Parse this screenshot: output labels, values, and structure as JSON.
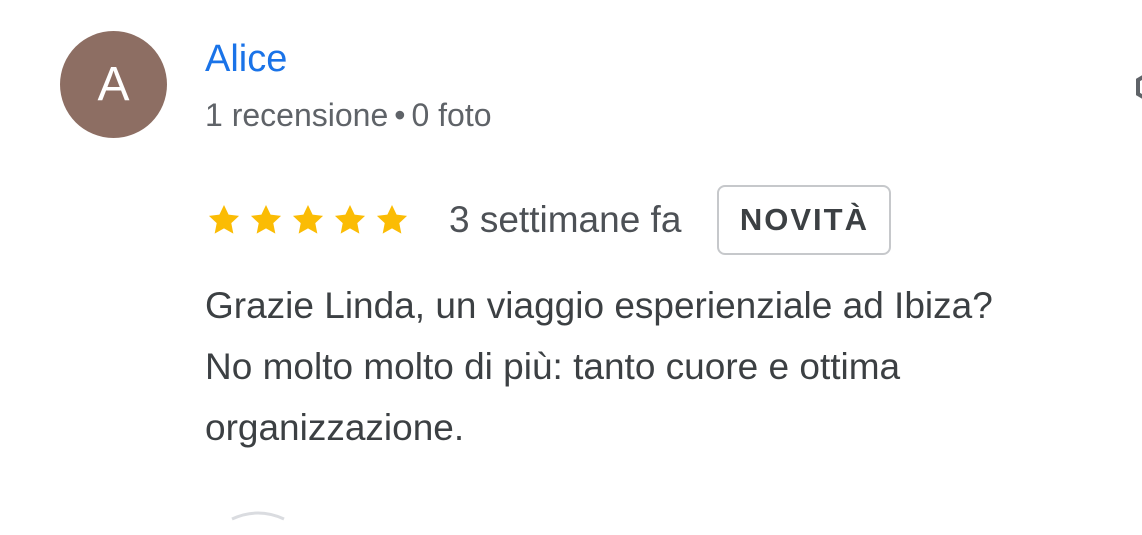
{
  "author": {
    "initial": "A",
    "name": "Alice",
    "reviews_count": "1 recensione",
    "separator": "•",
    "photos_count": "0 foto",
    "avatar_color": "#8d6e63",
    "name_color": "#1a73e8"
  },
  "review": {
    "rating": 5,
    "max_rating": 5,
    "star_color": "#fbbc04",
    "time_ago": "3 settimane fa",
    "badge": "NOVITÀ",
    "text_lines": [
      "Grazie Linda, un viaggio esperienziale ad Ibiza?",
      "No molto molto di più: tanto cuore e ottima",
      "organizzazione."
    ]
  },
  "icons": {
    "more": "more-options-icon",
    "star": "star-icon"
  }
}
